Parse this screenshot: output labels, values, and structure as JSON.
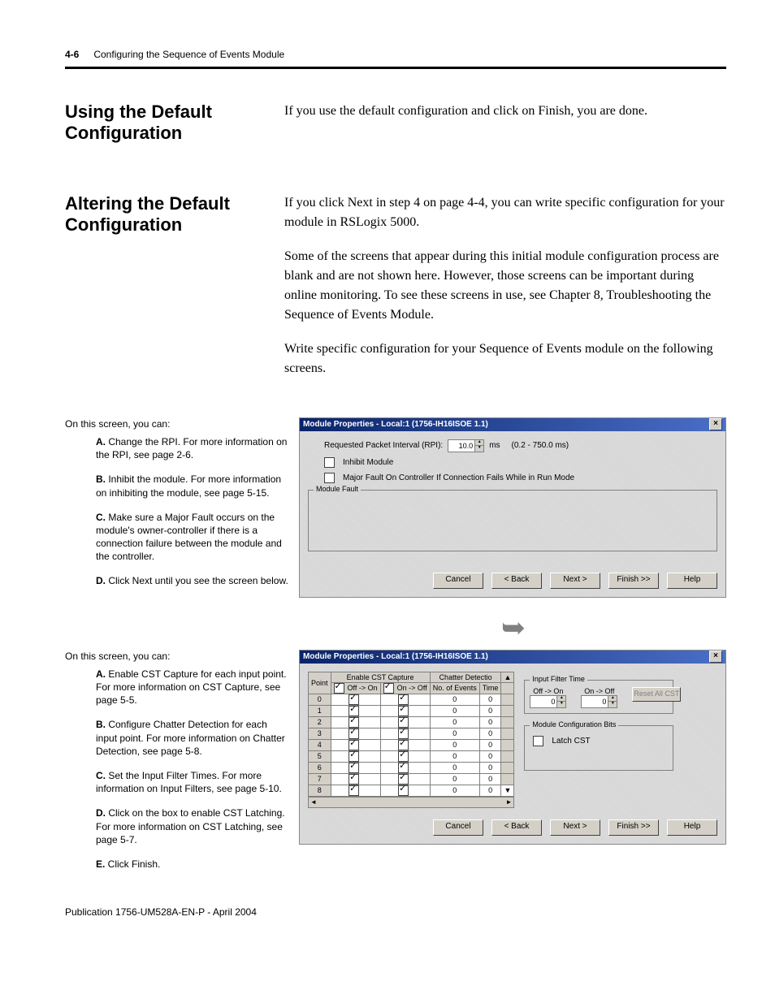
{
  "header": {
    "page_num": "4-6",
    "chapter_title": "Configuring the Sequence of Events Module"
  },
  "s1": {
    "heading": "Using the Default Configuration",
    "body": "If you use the default configuration and click on Finish, you are done."
  },
  "s2": {
    "heading": "Altering the Default Configuration",
    "p1": "If you click Next in step 4 on page 4-4, you can write specific configuration for your module in RSLogix 5000.",
    "p2": "Some of the screens that appear during this initial module configuration process are blank and are not shown here. However, those screens can be important during online monitoring. To see these screens in use, see Chapter 8, Troubleshooting the Sequence of Events Module.",
    "p3": "Write specific configuration for your Sequence of Events module on the following screens."
  },
  "annot1": {
    "intro": "On this screen, you can:",
    "A": "Change the RPI. For more information on the RPI, see page 2-6.",
    "B": "Inhibit the module. For more information on inhibiting the module, see page 5-15.",
    "C": "Make sure a Major Fault occurs on the module's owner-controller if there is a connection failure between the module and the controller.",
    "D": "Click Next until you see the screen below."
  },
  "annot2": {
    "intro": "On this screen, you can:",
    "A": "Enable CST Capture for each input point. For more information on CST Capture, see page 5-5.",
    "B": "Configure Chatter Detection for each input point. For more information on Chatter Detection, see page 5-8.",
    "C": "Set the Input Filter Times. For more information on Input Filters, see page 5-10.",
    "D": "Click on the box to enable CST Latching. For more information on CST Latching, see page 5-7.",
    "E": "Click Finish."
  },
  "dlg": {
    "title": "Module Properties - Local:1 (1756-IH16ISOE 1.1)",
    "rpi_label": "Requested Packet Interval (RPI):",
    "rpi_value": "10.0",
    "rpi_unit": "ms",
    "rpi_range": "(0.2 - 750.0 ms)",
    "inhibit": "Inhibit Module",
    "major_fault": "Major Fault On Controller If Connection Fails While in Run Mode",
    "module_fault": "Module Fault",
    "btn_cancel": "Cancel",
    "btn_back": "< Back",
    "btn_next": "Next >",
    "btn_finish": "Finish >>",
    "btn_help": "Help"
  },
  "dlg2": {
    "point": "Point",
    "enable_cst": "Enable CST Capture",
    "chatter": "Chatter Detectio",
    "off_on": "Off -> On",
    "on_off": "On -> Off",
    "noev": "No. of Events",
    "time": "Time",
    "ift": "Input Filter Time",
    "ift_off_on": "Off -> On",
    "ift_on_off": "On -> Off",
    "ift_val": "0",
    "reset": "Reset All CST",
    "mcb": "Module Configuration Bits",
    "latch": "Latch CST",
    "rows": [
      "0",
      "1",
      "2",
      "3",
      "4",
      "5",
      "6",
      "7",
      "8"
    ]
  },
  "footer": "Publication 1756-UM528A-EN-P - April 2004"
}
